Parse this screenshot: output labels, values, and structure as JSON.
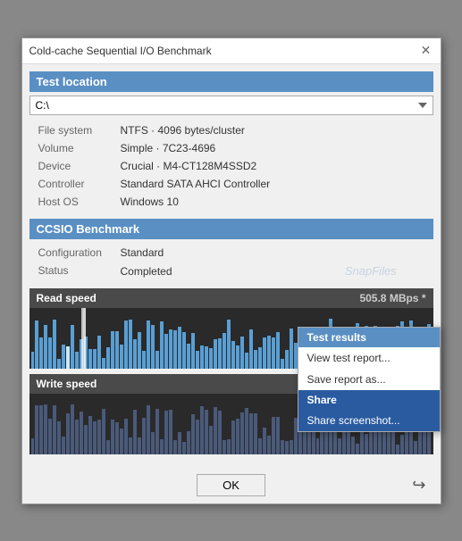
{
  "window": {
    "title": "Cold-cache Sequential I/O Benchmark",
    "close_label": "✕"
  },
  "test_location": {
    "header": "Test location",
    "drive": "C:\\"
  },
  "file_info": [
    {
      "label": "File system",
      "value": "NTFS  ·  4096 bytes/cluster"
    },
    {
      "label": "Volume",
      "value": "Simple  ·  7C23-4696"
    },
    {
      "label": "Device",
      "value": "Crucial  ·  M4-CT128M4SSD2"
    },
    {
      "label": "Controller",
      "value": "Standard SATA AHCI Controller"
    },
    {
      "label": "Host OS",
      "value": "Windows 10"
    }
  ],
  "benchmark": {
    "header": "CCSIO Benchmark",
    "config_label": "Configuration",
    "config_value": "Standard",
    "status_label": "Status",
    "status_value": "Completed"
  },
  "read_speed": {
    "header": "Read speed",
    "value": "505.8 MBps *"
  },
  "write_speed": {
    "header": "Write speed"
  },
  "context_menu": {
    "results_header": "Test results",
    "view_report": "View test report...",
    "save_report": "Save report as...",
    "share_header": "Share",
    "share_screenshot": "Share screenshot..."
  },
  "footer": {
    "ok_label": "OK"
  },
  "watermark": "SnapFiles"
}
